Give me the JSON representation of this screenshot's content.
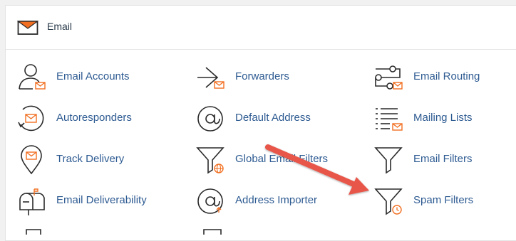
{
  "header": {
    "title": "Email",
    "icon": "envelope-icon"
  },
  "colors": {
    "accent": "#f26f21",
    "link": "#2e5b92",
    "annotation_arrow": "#e8574a"
  },
  "items": [
    {
      "label": "Email Accounts",
      "icon": "email-accounts-icon"
    },
    {
      "label": "Forwarders",
      "icon": "forwarders-icon"
    },
    {
      "label": "Email Routing",
      "icon": "email-routing-icon"
    },
    {
      "label": "Autoresponders",
      "icon": "autoresponders-icon"
    },
    {
      "label": "Default Address",
      "icon": "default-address-icon"
    },
    {
      "label": "Mailing Lists",
      "icon": "mailing-lists-icon"
    },
    {
      "label": "Track Delivery",
      "icon": "track-delivery-icon"
    },
    {
      "label": "Global Email Filters",
      "icon": "global-filter-icon"
    },
    {
      "label": "Email Filters",
      "icon": "filter-icon"
    },
    {
      "label": "Email Deliverability",
      "icon": "mailbox-icon"
    },
    {
      "label": "Address Importer",
      "icon": "address-importer-icon"
    },
    {
      "label": "Spam Filters",
      "icon": "spam-filter-icon"
    }
  ]
}
